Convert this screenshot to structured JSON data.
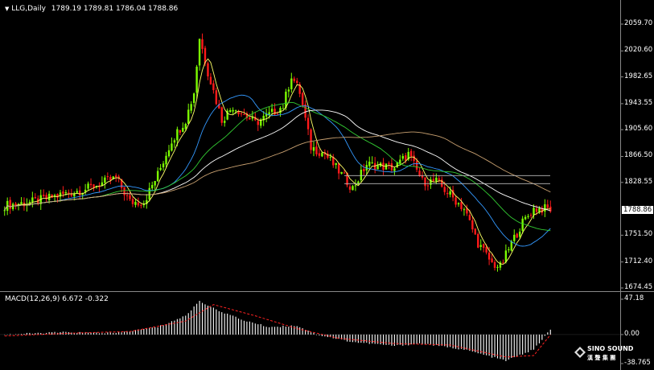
{
  "main_panel": {
    "header": {
      "symbol_period": "LLG,Daily",
      "ohlc": "1789.19 1789.81 1786.04 1788.86"
    },
    "current_price": "1788.86",
    "y_ticks": [
      "2059.70",
      "2020.60",
      "1982.65",
      "1943.55",
      "1905.60",
      "1866.50",
      "1828.55",
      "1751.50",
      "1712.40",
      "1674.45"
    ],
    "ylim": [
      1674.45,
      2059.7
    ]
  },
  "macd_panel": {
    "label": "MACD(12,26,9) 6.672 -0.322",
    "y_ticks": [
      "47.18",
      "0.00",
      "-38.765"
    ],
    "ylim": [
      -38.765,
      47.18
    ]
  },
  "brand": {
    "name": "SINO SOUND",
    "name_cn": "漢 聲 集 團"
  },
  "colors": {
    "background": "#000000",
    "up_candle": "#7cfc00",
    "down_candle": "#ff1a1a",
    "ma_fast": "#ffff66",
    "ma_mid": "#3399ff",
    "ma_slow": "#33cc33",
    "ma_long": "#ffffff",
    "ma_longer": "#c8a070",
    "hline": "#bbbbbb",
    "histogram": "#ffffff",
    "signal": "#ff2222"
  },
  "chart_data": {
    "type": "candlestick",
    "anchor_points_close": [
      [
        0,
        1795
      ],
      [
        10,
        1800
      ],
      [
        20,
        1810
      ],
      [
        30,
        1820
      ],
      [
        40,
        1835
      ],
      [
        45,
        1800
      ],
      [
        50,
        1800
      ],
      [
        55,
        1840
      ],
      [
        60,
        1890
      ],
      [
        65,
        1920
      ],
      [
        68,
        1960
      ],
      [
        70,
        2040
      ],
      [
        73,
        1990
      ],
      [
        78,
        1920
      ],
      [
        82,
        1940
      ],
      [
        90,
        1915
      ],
      [
        100,
        1940
      ],
      [
        103,
        1985
      ],
      [
        106,
        1960
      ],
      [
        110,
        1880
      ],
      [
        115,
        1870
      ],
      [
        120,
        1845
      ],
      [
        125,
        1820
      ],
      [
        130,
        1855
      ],
      [
        140,
        1850
      ],
      [
        145,
        1870
      ],
      [
        150,
        1830
      ],
      [
        155,
        1830
      ],
      [
        160,
        1810
      ],
      [
        165,
        1790
      ],
      [
        170,
        1740
      ],
      [
        175,
        1710
      ],
      [
        178,
        1705
      ],
      [
        182,
        1740
      ],
      [
        186,
        1770
      ],
      [
        190,
        1790
      ],
      [
        194,
        1790
      ],
      [
        196,
        1789
      ]
    ],
    "x_count": 197,
    "moving_averages": [
      "fast",
      "mid",
      "slow",
      "long",
      "longer"
    ],
    "horizontal_lines": [
      1838.5,
      1826.8
    ],
    "macd": {
      "hist_anchor_points": [
        [
          0,
          0
        ],
        [
          20,
          3
        ],
        [
          40,
          2
        ],
        [
          55,
          10
        ],
        [
          65,
          25
        ],
        [
          70,
          45
        ],
        [
          75,
          35
        ],
        [
          85,
          20
        ],
        [
          95,
          10
        ],
        [
          105,
          12
        ],
        [
          112,
          0
        ],
        [
          125,
          -10
        ],
        [
          140,
          -15
        ],
        [
          150,
          -12
        ],
        [
          165,
          -20
        ],
        [
          180,
          -35
        ],
        [
          190,
          -20
        ],
        [
          196,
          6.672
        ]
      ],
      "signal_anchor_points": [
        [
          0,
          -2
        ],
        [
          25,
          2
        ],
        [
          45,
          4
        ],
        [
          65,
          18
        ],
        [
          75,
          40
        ],
        [
          90,
          25
        ],
        [
          105,
          8
        ],
        [
          120,
          -5
        ],
        [
          140,
          -12
        ],
        [
          160,
          -14
        ],
        [
          180,
          -30
        ],
        [
          190,
          -28
        ],
        [
          196,
          -0.322
        ]
      ]
    }
  }
}
